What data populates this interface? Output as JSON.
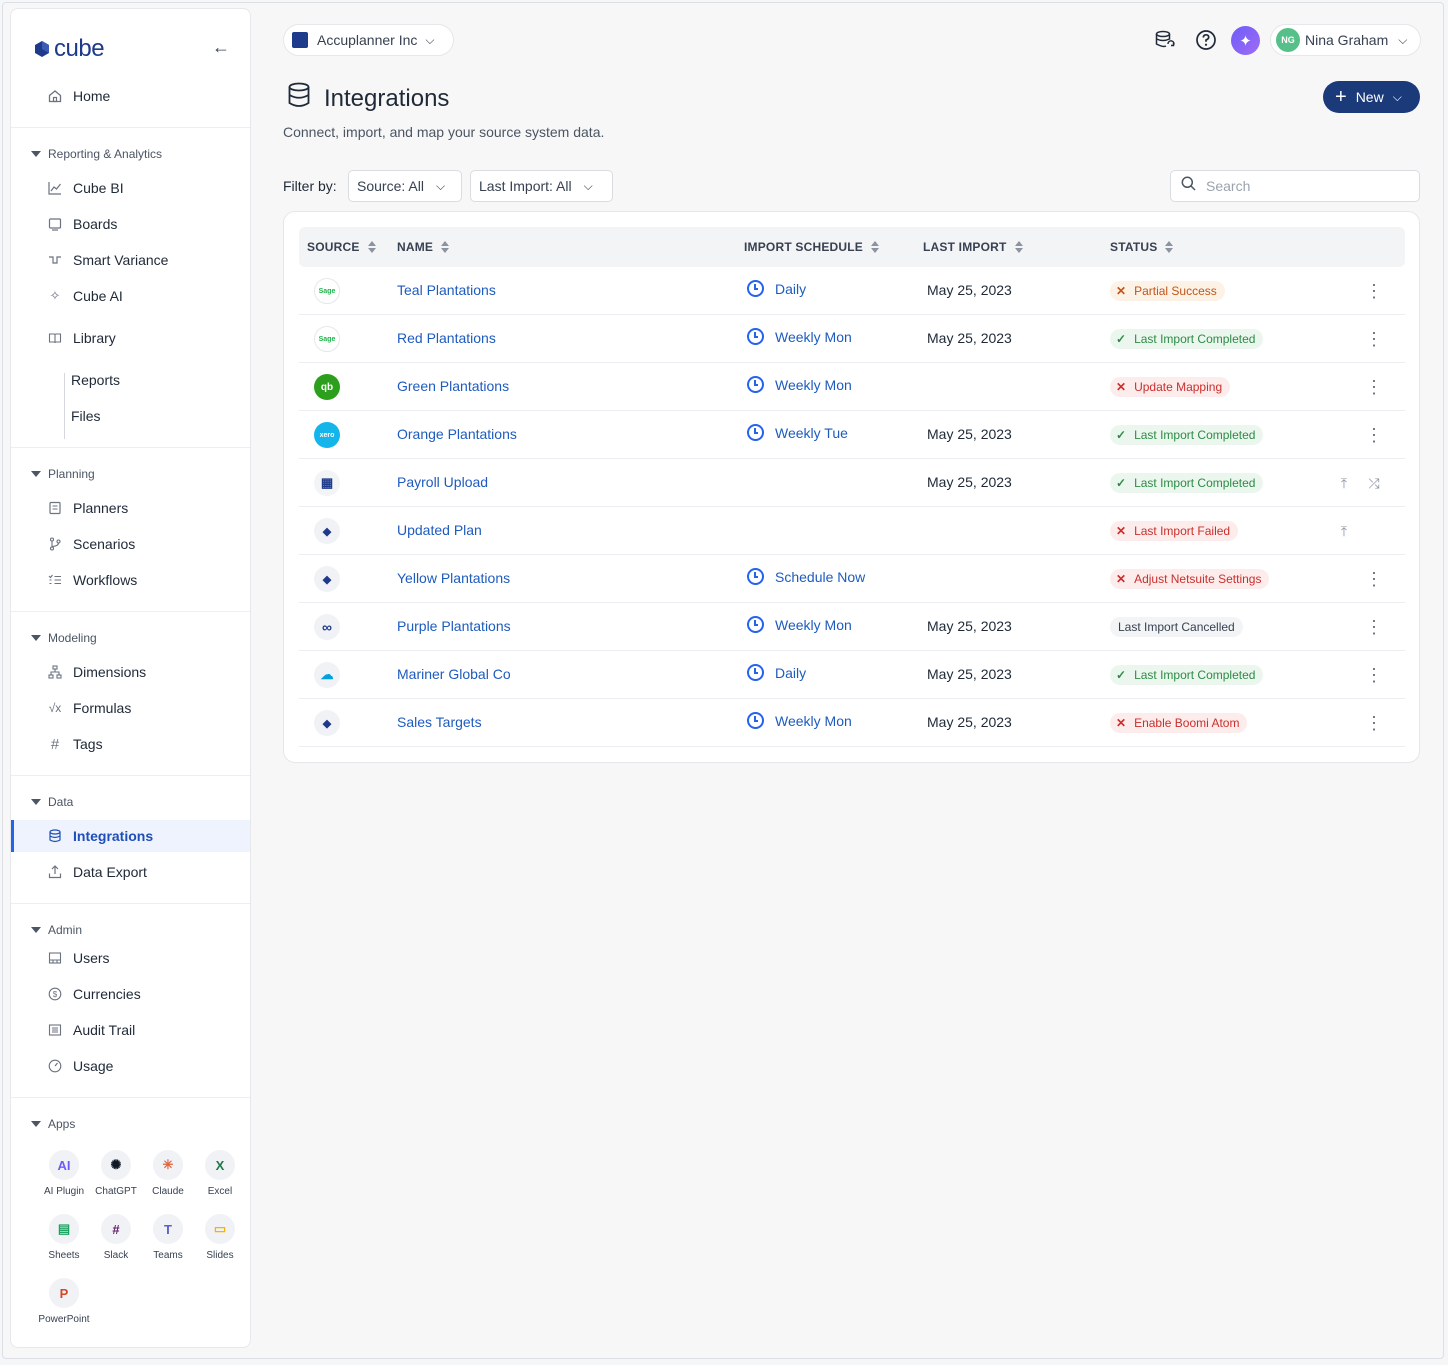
{
  "app": {
    "logo_text": "cube",
    "brand_color": "#1e3a8a"
  },
  "sidebar": {
    "home": "Home",
    "sections": {
      "reporting": "Reporting & Analytics",
      "planning": "Planning",
      "modeling": "Modeling",
      "data": "Data",
      "admin": "Admin",
      "apps": "Apps"
    },
    "items": {
      "cube_bi": "Cube BI",
      "boards": "Boards",
      "smart_variance": "Smart Variance",
      "cube_ai": "Cube AI",
      "library": "Library",
      "reports": "Reports",
      "files": "Files",
      "planners": "Planners",
      "scenarios": "Scenarios",
      "workflows": "Workflows",
      "dimensions": "Dimensions",
      "formulas": "Formulas",
      "tags": "Tags",
      "integrations": "Integrations",
      "data_export": "Data Export",
      "users": "Users",
      "currencies": "Currencies",
      "audit_trail": "Audit Trail",
      "usage": "Usage"
    },
    "apps": [
      {
        "label": "AI Plugin",
        "icon": "ai-plugin-icon",
        "color": "#6d5df7",
        "glyph": "AI"
      },
      {
        "label": "ChatGPT",
        "icon": "chatgpt-icon",
        "color": "#111827",
        "glyph": "✺"
      },
      {
        "label": "Claude",
        "icon": "claude-icon",
        "color": "#e0673f",
        "glyph": "✳"
      },
      {
        "label": "Excel",
        "icon": "excel-icon",
        "color": "#1d7a45",
        "glyph": "X"
      },
      {
        "label": "Sheets",
        "icon": "sheets-icon",
        "color": "#1ea362",
        "glyph": "▤"
      },
      {
        "label": "Slack",
        "icon": "slack-icon",
        "color": "#611f69",
        "glyph": "#"
      },
      {
        "label": "Teams",
        "icon": "teams-icon",
        "color": "#5b5fc7",
        "glyph": "T"
      },
      {
        "label": "Slides",
        "icon": "slides-icon",
        "color": "#f4b400",
        "glyph": "▭"
      },
      {
        "label": "PowerPoint",
        "icon": "powerpoint-icon",
        "color": "#d24726",
        "glyph": "P"
      }
    ]
  },
  "topbar": {
    "org": "Accuplanner Inc",
    "user_initials": "NG",
    "user_name": "Nina Graham"
  },
  "page": {
    "title": "Integrations",
    "subtitle": "Connect, import, and map your source system data.",
    "new_label": "New",
    "filter_label": "Filter by:",
    "filter_source": "Source: All",
    "filter_last_import": "Last Import: All",
    "search_placeholder": "Search"
  },
  "table": {
    "headers": {
      "source": "SOURCE",
      "name": "NAME",
      "schedule": "IMPORT SCHEDULE",
      "last_import": "LAST IMPORT",
      "status": "STATUS"
    },
    "rows": [
      {
        "source": "Sage",
        "name": "Teal Plantations",
        "schedule": "Daily",
        "last_import": "May 25, 2023",
        "status": "Partial Success",
        "status_type": "warn",
        "actions": "kebab"
      },
      {
        "source": "Sage",
        "name": "Red Plantations",
        "schedule": "Weekly Mon",
        "last_import": "May 25, 2023",
        "status": "Last Import Completed",
        "status_type": "ok",
        "actions": "kebab"
      },
      {
        "source": "QuickBooks",
        "name": "Green Plantations",
        "schedule": "Weekly Mon",
        "last_import": "",
        "status": "Update Mapping",
        "status_type": "err",
        "actions": "kebab"
      },
      {
        "source": "Xero",
        "name": "Orange Plantations",
        "schedule": "Weekly Tue",
        "last_import": "May 25, 2023",
        "status": "Last Import Completed",
        "status_type": "ok",
        "actions": "kebab"
      },
      {
        "source": "Spreadsheet",
        "name": "Payroll Upload",
        "schedule": "",
        "last_import": "May 25, 2023",
        "status": "Last Import Completed",
        "status_type": "ok",
        "actions": "upload-shuffle"
      },
      {
        "source": "Cube",
        "name": "Updated Plan",
        "schedule": "",
        "last_import": "",
        "status": "Last Import Failed",
        "status_type": "err",
        "actions": "upload"
      },
      {
        "source": "Cube",
        "name": "Yellow Plantations",
        "schedule": "Schedule Now",
        "last_import": "",
        "status": "Adjust Netsuite Settings",
        "status_type": "err",
        "actions": "kebab"
      },
      {
        "source": "Workato",
        "name": "Purple Plantations",
        "schedule": "Weekly Mon",
        "last_import": "May 25, 2023",
        "status": "Last Import Cancelled",
        "status_type": "neutral",
        "actions": "kebab"
      },
      {
        "source": "Salesforce",
        "name": "Mariner Global Co",
        "schedule": "Daily",
        "last_import": "May 25, 2023",
        "status": "Last Import Completed",
        "status_type": "ok",
        "actions": "kebab"
      },
      {
        "source": "Cube",
        "name": "Sales Targets",
        "schedule": "Weekly Mon",
        "last_import": "May 25, 2023",
        "status": "Enable Boomi Atom",
        "status_type": "err",
        "actions": "kebab"
      }
    ]
  }
}
